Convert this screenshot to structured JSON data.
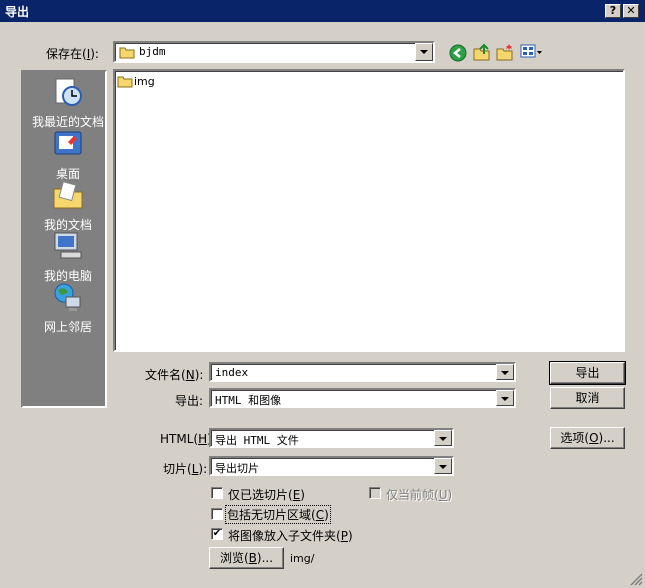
{
  "window": {
    "title": "导出",
    "help_label": "?",
    "close_label": "✕"
  },
  "save_in": {
    "label": "保存在",
    "mnemonic": "I",
    "value": "bjdm"
  },
  "places": [
    {
      "label": "我最近的文档",
      "icon": "recent-documents-icon"
    },
    {
      "label": "桌面",
      "icon": "desktop-icon"
    },
    {
      "label": "我的文档",
      "icon": "my-documents-icon"
    },
    {
      "label": "我的电脑",
      "icon": "my-computer-icon"
    },
    {
      "label": "网上邻居",
      "icon": "network-places-icon"
    }
  ],
  "files": [
    {
      "name": "img",
      "icon": "folder-icon"
    }
  ],
  "filename": {
    "label": "文件名",
    "mnemonic": "N",
    "value": "index"
  },
  "export_type": {
    "label": "导出:",
    "value": "HTML 和图像"
  },
  "buttons": {
    "export": "导出",
    "cancel": "取消",
    "options": "选项",
    "options_mnemonic": "O",
    "browse": "浏览",
    "browse_mnemonic": "B"
  },
  "html": {
    "label": "HTML",
    "mnemonic": "H",
    "value": "导出 HTML 文件"
  },
  "slices": {
    "label": "切片",
    "mnemonic": "L",
    "value": "导出切片"
  },
  "checkboxes": {
    "selected_only": {
      "label": "仅已选切片",
      "mnemonic": "E",
      "checked": false
    },
    "current_frame": {
      "label": "仅当前帧",
      "mnemonic": "U",
      "checked": false,
      "disabled": true
    },
    "include_unsliced": {
      "label": "包括无切片区域",
      "mnemonic": "C",
      "checked": false
    },
    "images_subfolder": {
      "label": "将图像放入子文件夹",
      "mnemonic": "P",
      "checked": true
    }
  },
  "subfolder_path": "img/"
}
